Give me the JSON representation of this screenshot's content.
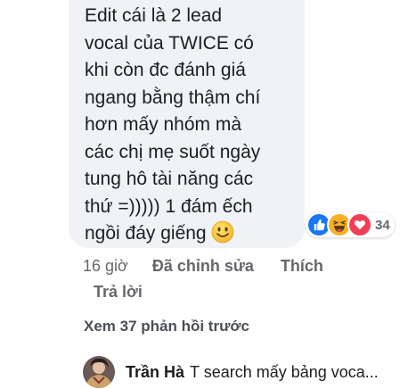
{
  "comment": {
    "lines": "Edit cái là 2 lead\nvocal của TWICE có\nkhi còn đc đánh giá\nngang bằng thậm chí\nhơn mấy nhóm mà\ncác chị mẹ suốt ngày\ntung hô tài năng các\nthứ =))))) 1 đám ếch\nngồi đáy giếng ",
    "emoji": "smiling-face-emoji"
  },
  "reactions": {
    "icons": [
      "like-icon",
      "haha-icon",
      "love-icon"
    ],
    "count": "34",
    "colors": {
      "like": "#1877f2",
      "haha": "#f7b125",
      "love": "#f33e58"
    }
  },
  "actions": {
    "time": "16 giờ",
    "edited": "Đã chỉnh sửa",
    "like": "Thích",
    "reply": "Trả lời"
  },
  "view_previous": "Xem 37 phản hồi trước",
  "latest_reply": {
    "name": "Trần Hà",
    "snippet": "T search mấy bảng voca..."
  }
}
